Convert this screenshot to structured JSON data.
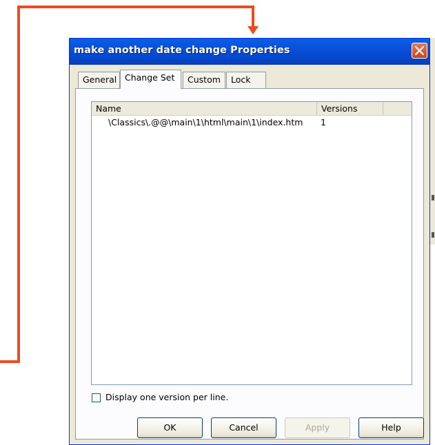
{
  "dialog": {
    "title": "make another date change Properties"
  },
  "tabs": [
    {
      "label": "General",
      "active": false
    },
    {
      "label": "Change Set",
      "active": true
    },
    {
      "label": "Custom",
      "active": false
    },
    {
      "label": "Lock",
      "active": false
    }
  ],
  "list": {
    "columns": [
      "Name",
      "Versions"
    ],
    "rows": [
      {
        "name": "\\Classics\\.@@\\main\\1\\html\\main\\1\\index.htm",
        "versions": "1"
      }
    ]
  },
  "options": {
    "display_one_version_label": "Display one version per line.",
    "display_one_version_checked": false
  },
  "buttons": {
    "ok": "OK",
    "cancel": "Cancel",
    "apply": "Apply",
    "help": "Help"
  },
  "colors": {
    "annotation_arrow": "#ef4a1f",
    "titlebar": "#0a4fd8"
  },
  "icons": {
    "close": "close-icon",
    "annotation": "red-arrow"
  }
}
